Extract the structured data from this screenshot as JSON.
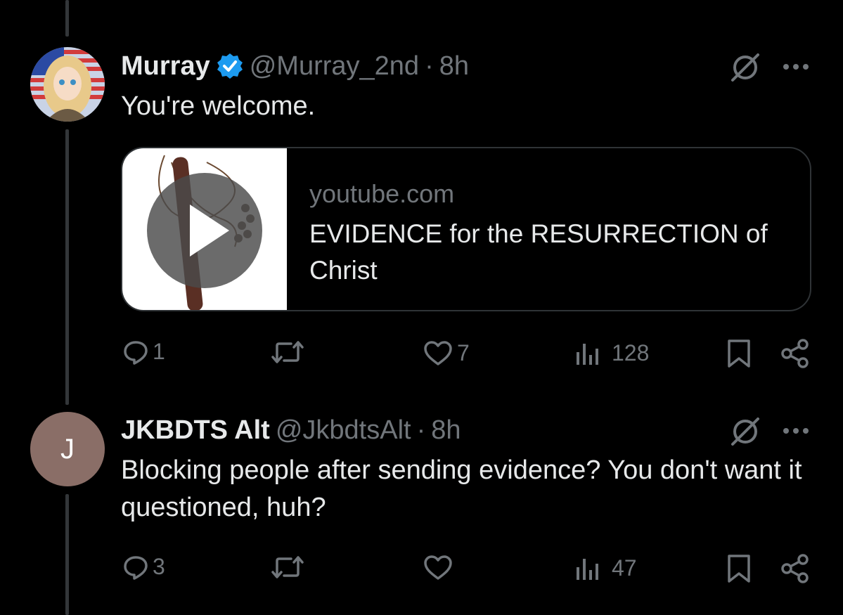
{
  "tweets": [
    {
      "name": "Murray",
      "handle": "@Murray_2nd",
      "separator": "·",
      "time": "8h",
      "verified": true,
      "text": "You're welcome.",
      "card": {
        "domain": "youtube.com",
        "title": "EVIDENCE for the RESURRECTION of Christ"
      },
      "actions": {
        "replies": "1",
        "reposts": "",
        "likes": "7",
        "views": "128"
      }
    },
    {
      "name": "JKBDTS Alt",
      "handle": "@JkbdtsAlt",
      "separator": "·",
      "time": "8h",
      "avatar_letter": "J",
      "avatar_color": "#8a6e67",
      "text": "Blocking people after sending evidence? You don't want it questioned, huh?",
      "actions": {
        "replies": "3",
        "reposts": "",
        "likes": "",
        "views": "47"
      }
    }
  ],
  "colors": {
    "accent": "#1d9bf0",
    "muted": "#71767b",
    "text": "#e7e9ea",
    "background": "#000000"
  },
  "icons": [
    "reply-icon",
    "repost-icon",
    "like-icon",
    "views-icon",
    "bookmark-icon",
    "share-icon",
    "grok-icon",
    "more-icon",
    "play-icon",
    "verified-icon"
  ]
}
